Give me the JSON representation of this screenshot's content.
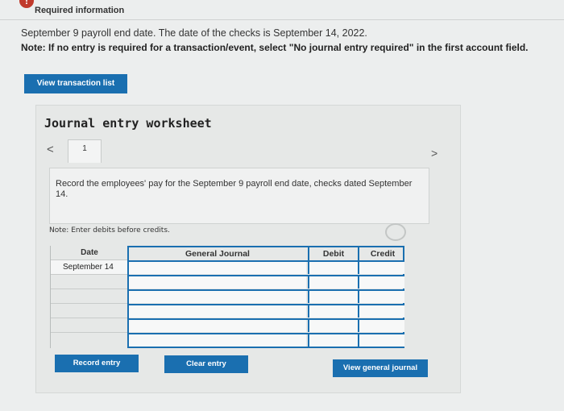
{
  "header": {
    "alert_icon": "!",
    "required_label": "Required information",
    "description": "September 9 payroll end date. The date of the checks is September 14, 2022.",
    "note": "Note: If no entry is required for a transaction/event, select \"No journal entry required\" in the first account field."
  },
  "buttons": {
    "view_transaction_list": "View transaction list",
    "record_entry": "Record entry",
    "clear_entry": "Clear entry",
    "view_general_journal": "View general journal"
  },
  "worksheet": {
    "title": "Journal entry worksheet",
    "prev_glyph": "<",
    "next_glyph": ">",
    "tab_label": "1",
    "instruction": "Record the employees' pay for the September 9 payroll end date, checks dated September 14.",
    "note": "Note: Enter debits before credits."
  },
  "table": {
    "headers": {
      "date": "Date",
      "general_journal": "General Journal",
      "debit": "Debit",
      "credit": "Credit"
    },
    "rows": [
      {
        "date": "September 14",
        "account": "",
        "debit": "",
        "credit": ""
      },
      {
        "date": "",
        "account": "",
        "debit": "",
        "credit": ""
      },
      {
        "date": "",
        "account": "",
        "debit": "",
        "credit": ""
      },
      {
        "date": "",
        "account": "",
        "debit": "",
        "credit": ""
      },
      {
        "date": "",
        "account": "",
        "debit": "",
        "credit": ""
      },
      {
        "date": "",
        "account": "",
        "debit": "",
        "credit": ""
      }
    ]
  },
  "colors": {
    "accent": "#1a6fb0",
    "alert": "#c0392b"
  }
}
